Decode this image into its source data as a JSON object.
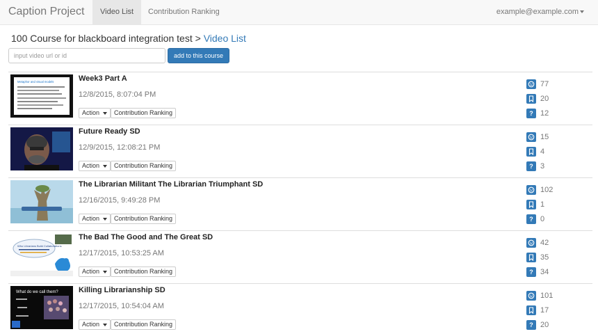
{
  "navbar": {
    "brand": "Caption Project",
    "tabs": [
      {
        "label": "Video List",
        "active": true
      },
      {
        "label": "Contribution Ranking",
        "active": false
      }
    ],
    "user": "example@example.com"
  },
  "header": {
    "course": "100 Course for blackboard integration test",
    "separator": ">",
    "crumb": "Video List"
  },
  "add_form": {
    "input_placeholder": "input video url or id",
    "input_value": "",
    "button_label": "add to this course"
  },
  "row_buttons": {
    "action_label": "Action",
    "ranking_label": "Contribution Ranking"
  },
  "videos": [
    {
      "title": "Week3 Part A",
      "date": "12/8/2015, 8:07:04 PM",
      "stats": [
        "77",
        "20",
        "12"
      ]
    },
    {
      "title": "Future Ready SD",
      "date": "12/9/2015, 12:08:21 PM",
      "stats": [
        "15",
        "4",
        "3"
      ]
    },
    {
      "title": "The Librarian Militant The Librarian Triumphant SD",
      "date": "12/16/2015, 9:49:28 PM",
      "stats": [
        "102",
        "1",
        "0"
      ]
    },
    {
      "title": "The Bad The Good and The Great SD",
      "date": "12/17/2015, 10:53:25 AM",
      "stats": [
        "42",
        "35",
        "34"
      ]
    },
    {
      "title": "Killing Librarianship SD",
      "date": "12/17/2015, 10:54:04 AM",
      "stats": [
        "101",
        "17",
        "20"
      ]
    }
  ],
  "thumbnails": {
    "t1_heading": "Metaphor and visual models",
    "t4_bubble": "Who Librarians Build Collaborations",
    "t5_heading": "What do we call them?"
  },
  "icons": {
    "stat1": "face-icon",
    "stat2": "bookmark-icon",
    "stat3": "question-icon"
  },
  "colors": {
    "primary": "#337ab7",
    "link": "#337ab7",
    "navbar_bg": "#f8f8f8"
  }
}
